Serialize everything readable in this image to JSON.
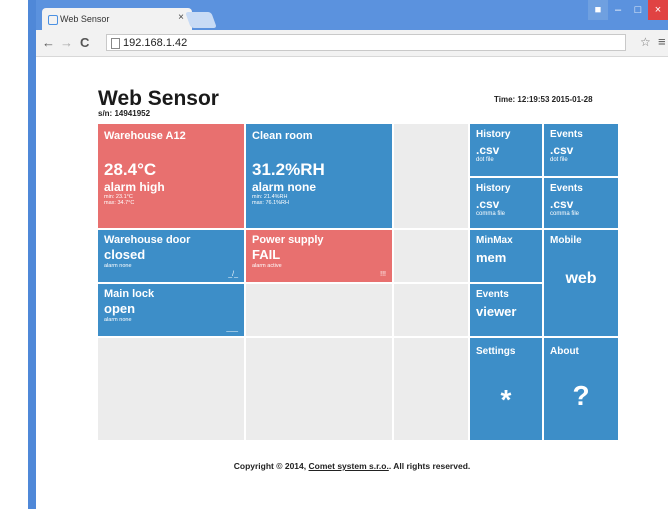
{
  "browser": {
    "tab_title": "Web Sensor",
    "tab_close": "×",
    "url": "192.168.1.42",
    "back_icon": "←",
    "forward_icon": "→",
    "reload_icon": "C",
    "star_icon": "☆",
    "menu_icon": "≡",
    "win_minimize": "–",
    "win_maximize": "□",
    "win_close": "×"
  },
  "header": {
    "title": "Web Sensor",
    "serial": "s/n: 14941952",
    "time": "Time: 12:19:53 2015-01-28"
  },
  "tiles": {
    "warehouse_a12": {
      "title": "Warehouse A12",
      "value": "28.4°C",
      "alarm": "alarm high",
      "min": "min: 23.1°C",
      "max": "max: 34.7°C",
      "color": "#e8706f"
    },
    "clean_room": {
      "title": "Clean room",
      "value": "31.2%RH",
      "alarm": "alarm none",
      "min": "min: 21.4%RH",
      "max": "max: 76.1%RH",
      "color": "#3d8ec8"
    },
    "warehouse_door": {
      "title": "Warehouse door",
      "value": "closed",
      "alarm": "alarm none",
      "mark": "_/_"
    },
    "power_supply": {
      "title": "Power supply",
      "value": "FAIL",
      "alarm": "alarm active",
      "mark": "!!!"
    },
    "main_lock": {
      "title": "Main lock",
      "value": "open",
      "alarm": "alarm none",
      "mark": "___"
    }
  },
  "side": {
    "history_dat": {
      "title": "History",
      "ext": ".csv",
      "sub": "dot file"
    },
    "events_dat": {
      "title": "Events",
      "ext": ".csv",
      "sub": "dot file"
    },
    "history_comma": {
      "title": "History",
      "ext": ".csv",
      "sub": "comma file"
    },
    "events_comma": {
      "title": "Events",
      "ext": ".csv",
      "sub": "comma file"
    },
    "minmax": {
      "title": "MinMax",
      "label": "mem"
    },
    "mobile": {
      "title": "Mobile",
      "label": "web"
    },
    "events_viewer": {
      "title": "Events",
      "label": "viewer"
    },
    "settings": {
      "title": "Settings",
      "glyph": "*"
    },
    "about": {
      "title": "About",
      "glyph": "?"
    }
  },
  "footer": {
    "prefix": "Copyright © 2014,",
    "link": "Comet system s.r.o.",
    "suffix": "All rights reserved."
  }
}
